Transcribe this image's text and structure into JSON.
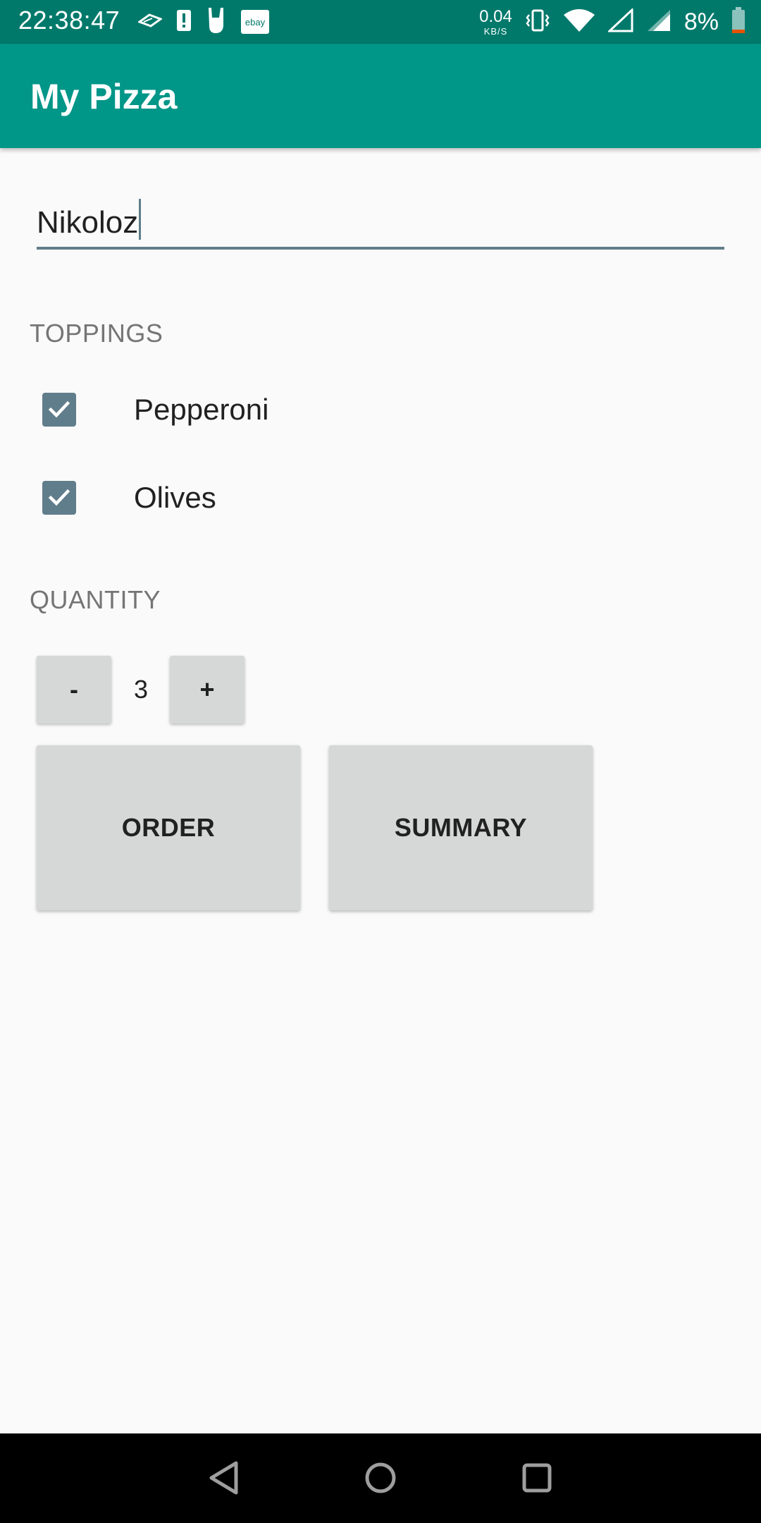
{
  "status_bar": {
    "time": "22:38:47",
    "left_icons": [
      "signal-stream-icon",
      "alert-icon",
      "rock-hand-icon",
      "ebay-icon"
    ],
    "ebay_label": "ebay",
    "net_speed_value": "0.04",
    "net_speed_unit": "KB/S",
    "battery_percent": "8%",
    "right_icons": [
      "vibrate-icon",
      "wifi-icon",
      "cell-signal-empty-icon",
      "cell-signal-icon",
      "battery-icon"
    ]
  },
  "app_bar": {
    "title": "My Pizza"
  },
  "name_field": {
    "value": "Nikoloz"
  },
  "toppings": {
    "label": "TOPPINGS",
    "items": [
      {
        "label": "Pepperoni",
        "checked": true
      },
      {
        "label": "Olives",
        "checked": true
      }
    ]
  },
  "quantity": {
    "label": "QUANTITY",
    "decrement_label": "-",
    "value": "3",
    "increment_label": "+"
  },
  "actions": {
    "order_label": "ORDER",
    "summary_label": "SUMMARY"
  },
  "nav_bar": {
    "icons": [
      "back-icon",
      "home-icon",
      "recents-icon"
    ]
  },
  "colors": {
    "status_bar": "#00796b",
    "app_bar": "#009688",
    "accent": "#607d8b",
    "button_bg": "#d6d7d7"
  }
}
